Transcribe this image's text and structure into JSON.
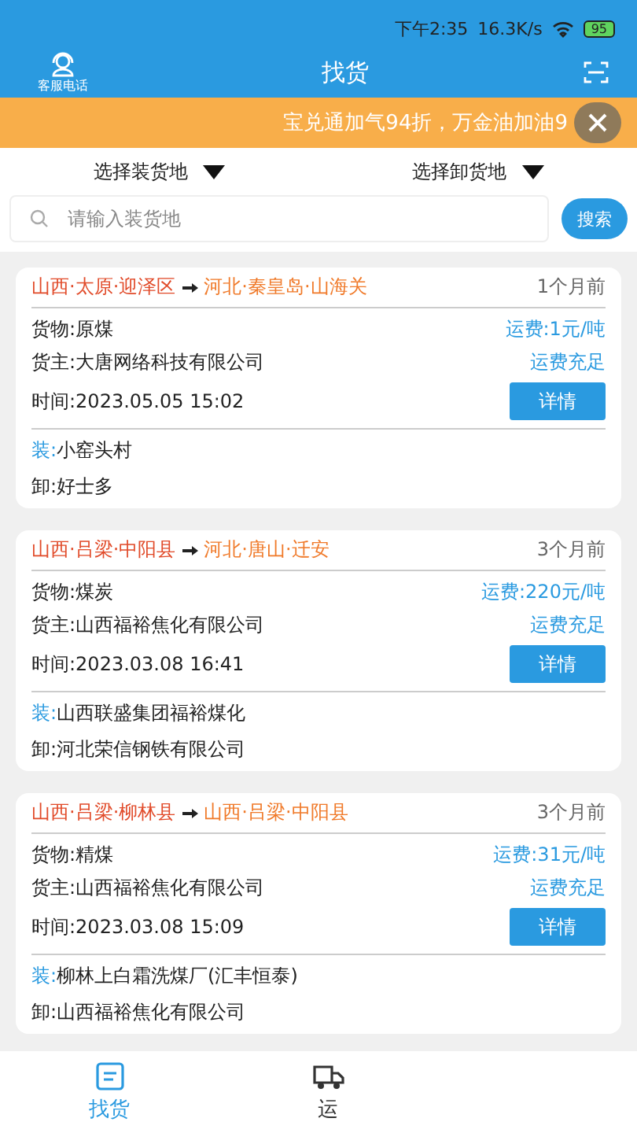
{
  "status_bar": {
    "time": "下午2:35",
    "speed": "16.3K/s",
    "battery": "95"
  },
  "header": {
    "left_label": "客服电话",
    "title": "找货"
  },
  "banner": {
    "text": "宝兑通加气94折，万金油加油9"
  },
  "filters": [
    {
      "label": "选择装货地"
    },
    {
      "label": "选择卸货地"
    }
  ],
  "search": {
    "placeholder": "请输入装货地",
    "button": "搜索"
  },
  "cards": [
    {
      "from": "山西·太原·迎泽区",
      "to": "河北·秦皇岛·山海关",
      "age": "1个月前",
      "cargo": "货物:原煤",
      "price": "运费:1元/吨",
      "owner": "货主:大唐网络科技有限公司",
      "status": "运费充足",
      "time": "时间:2023.05.05 15:02",
      "button": "详情",
      "load_label": "装:",
      "load": "小窑头村",
      "unload": "卸:好士多"
    },
    {
      "from": "山西·吕梁·中阳县",
      "to": "河北·唐山·迁安",
      "age": "3个月前",
      "cargo": "货物:煤炭",
      "price": "运费:220元/吨",
      "owner": "货主:山西福裕焦化有限公司",
      "status": "运费充足",
      "time": "时间:2023.03.08 16:41",
      "button": "详情",
      "load_label": "装:",
      "load": "山西联盛集团福裕煤化",
      "unload": "卸:河北荣信钢铁有限公司"
    },
    {
      "from": "山西·吕梁·柳林县",
      "to": "山西·吕梁·中阳县",
      "age": "3个月前",
      "cargo": "货物:精煤",
      "price": "运费:31元/吨",
      "owner": "货主:山西福裕焦化有限公司",
      "status": "运费充足",
      "time": "时间:2023.03.08 15:09",
      "button": "详情",
      "load_label": "装:",
      "load": "柳林上白霜洗煤厂(汇丰恒泰)",
      "unload": "卸:山西福裕焦化有限公司"
    }
  ],
  "tabs": [
    {
      "label": "找货",
      "kind": "list",
      "selected": true
    },
    {
      "label": "运",
      "kind": "truck",
      "selected": false
    }
  ]
}
